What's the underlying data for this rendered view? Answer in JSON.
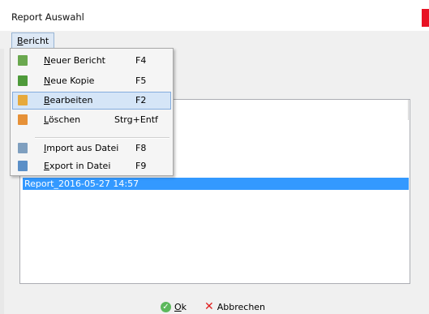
{
  "window": {
    "title": "Report Auswahl",
    "close_color": "#e81123"
  },
  "menubar": {
    "bericht_prefix": "B",
    "bericht_rest": "ericht"
  },
  "menu": {
    "items": [
      {
        "ul": "N",
        "rest": "euer Bericht",
        "key": "F4",
        "icon": "new-report-icon",
        "color": "#6aa84f"
      },
      {
        "ul": "N",
        "rest": "eue Kopie",
        "key": "F5",
        "icon": "copy-icon",
        "color": "#4e9a3a"
      },
      {
        "ul": "B",
        "rest": "earbeiten",
        "key": "F2",
        "icon": "edit-icon",
        "color": "#e6a93c"
      },
      {
        "ul": "L",
        "rest": "öschen",
        "key": "Strg+Entf",
        "icon": "delete-icon",
        "color": "#e69138"
      },
      {
        "ul": "I",
        "rest": "mport aus Datei",
        "key": "F8",
        "icon": "import-icon",
        "color": "#7f9fbf"
      },
      {
        "ul": "E",
        "rest": "xport in Datei",
        "key": "F9",
        "icon": "export-icon",
        "color": "#5b8fc7"
      }
    ],
    "highlighted_index": 2
  },
  "list": {
    "rows": [
      {
        "label": "Report_2016-05-27 14:57",
        "selected": true
      }
    ]
  },
  "buttons": {
    "ok_prefix": "O",
    "ok_rest": "k",
    "cancel_label": "Abbrechen",
    "ok_color": "#5cb85c",
    "cancel_color": "#e02020"
  }
}
